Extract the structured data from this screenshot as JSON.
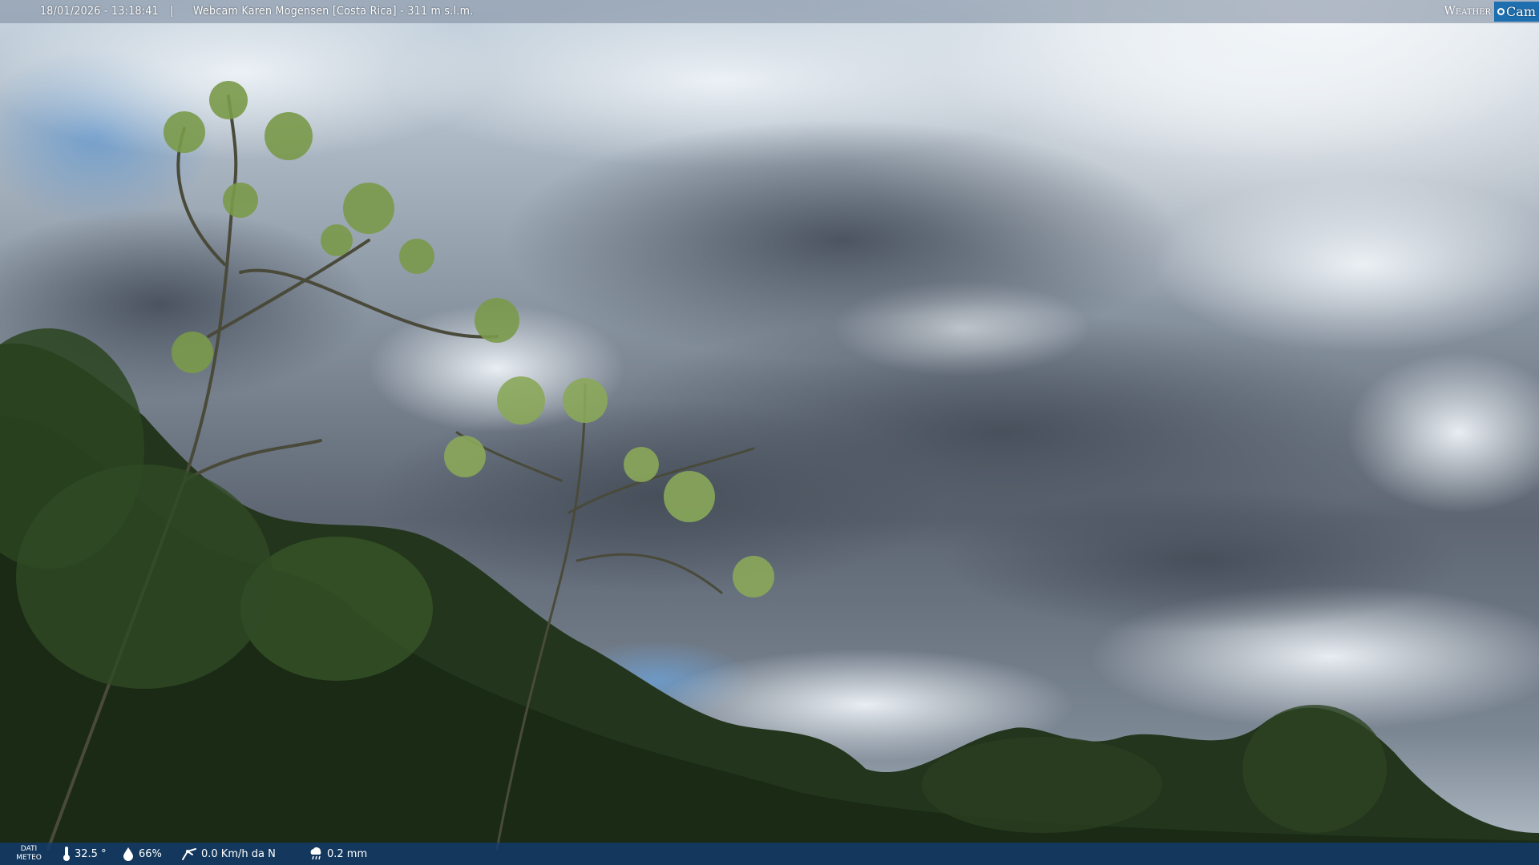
{
  "overlay_top": {
    "timestamp": "18/01/2026 - 13:18:41",
    "separator": "|",
    "title": "Webcam Karen Mogensen [Costa Rica]  - 311 m s.l.m.",
    "brand_weather": "Weather",
    "brand_cam": "Cam"
  },
  "overlay_bottom": {
    "dati_label_line1": "DATI",
    "dati_label_line2": "METEO",
    "temperature": "32.5 °",
    "humidity": "66%",
    "wind": "0.0 Km/h da N",
    "rain": "0.2 mm",
    "icons": {
      "temperature": "thermometer-icon",
      "humidity": "droplet-icon",
      "wind": "wind-icon",
      "rain": "rain-cloud-icon"
    }
  },
  "colors": {
    "sky_dark": "#4f5966",
    "sky_light": "#dfe7ee",
    "foliage": "#2f4a24",
    "bar_bottom": "#143c6e",
    "brand_blue": "#1e6fb0"
  }
}
